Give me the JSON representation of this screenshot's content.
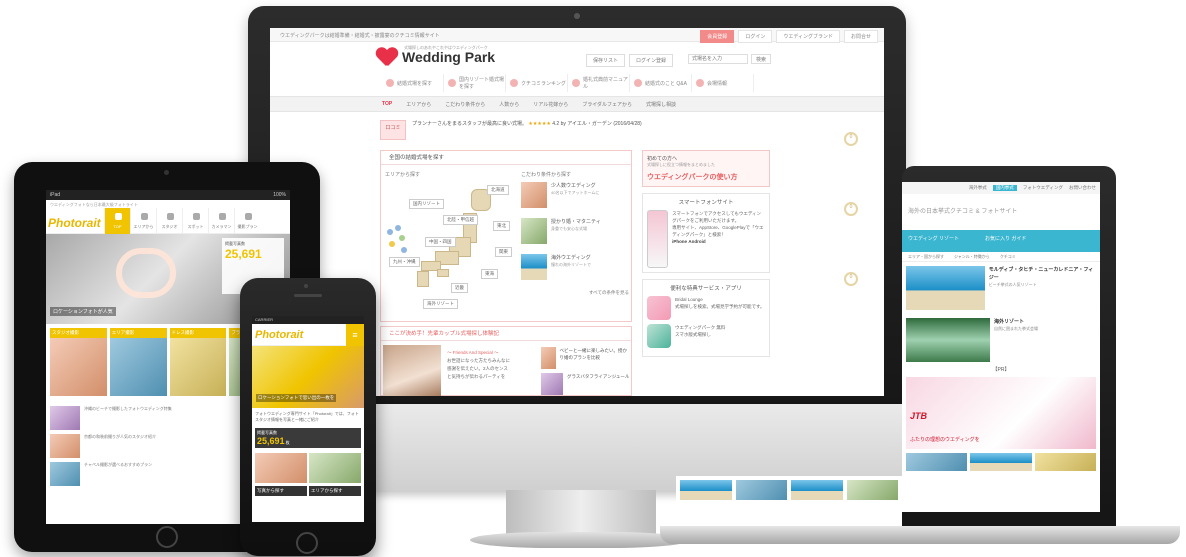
{
  "monitor": {
    "tagline": "ウエディングパークは結婚準備・結婚式・披露宴のクチコミ情報サイト",
    "top_links": [
      "会員登録",
      "ログイン",
      "ウエディングブランド",
      "お問合せ"
    ],
    "brand": "Wedding Park",
    "brand_sub": "式場探しのあれやこれやはウエディングパーク",
    "header_buttons": [
      "保存リスト",
      "ログイン登録"
    ],
    "search_placeholder": "式場名を入力",
    "search_button": "検索",
    "icon_nav": [
      "結婚式場を探す",
      "国内リゾート婚式場を探す",
      "クチコミランキング",
      "婚礼式典前マニュアル",
      "結婚式のこと Q&A",
      "会場情報"
    ],
    "global_nav": [
      "TOP",
      "エリアから",
      "こだわり条件から",
      "人数から",
      "リアル花嫁から",
      "ブライダルフェアから",
      "式場探し相談"
    ],
    "review": {
      "badge": "口コミ",
      "text": "プランナーさんをまるスタッフが最高に良い式場。",
      "stars": "★★★★★",
      "score": "4.2",
      "meta": "by アイエル・ガーデン (2016/04/28)"
    },
    "circle_labels": [
      "0",
      "0",
      "0"
    ],
    "map_panel": {
      "title": "全国の結婚式場を探す",
      "area_sub": "エリアから探す",
      "cond_sub": "こだわり条件から探す",
      "labels": [
        "北海道",
        "東北",
        "関東",
        "東海",
        "北陸・甲信越",
        "近畿",
        "中国・四国",
        "九州・沖縄",
        "国内リゾート",
        "海外リゾート"
      ],
      "conditions": [
        {
          "label": "少人数ウエディング",
          "small": "40名以下でアットホームに"
        },
        {
          "label": "授かり婚・マタニティ",
          "small": "身重でも安心な式場"
        },
        {
          "label": "海外ウエディング",
          "small": "憧れの海外リゾートで"
        }
      ],
      "more": "すべての条件を見る"
    },
    "lower_panel": {
      "title": "ここが決め手！先輩カップル式場探し体験記",
      "text_lines": [
        "〜 Friends And Special 〜",
        "お世話になった方たちみんなに",
        "感謝を伝えたい。2人のセンス",
        "と気持ちが伝わるパーティを"
      ],
      "items": [
        "ベビーと一緒に楽しみたい。授かり婚のプランを比較",
        "グラスバタフライアンジュール"
      ]
    },
    "first_visit": {
      "heading": "初めての方へ",
      "small": "式場探しに役立つ情報をまとめました",
      "big": "ウエディングパークの使い方"
    },
    "smartphone": {
      "title": "スマートフォンサイト",
      "text": "スマートフォンでアクセスしてもウエディングパークをご利用いただけます。",
      "text2": "専用サイト、AppStore、GooglePlayで「ウエディングパーク」と検索！",
      "os_ios": "iPhone",
      "os_android": "Android"
    },
    "apps": {
      "title": "便利な特典サービス・アプリ",
      "items": [
        {
          "name": "Bridal Lounge",
          "desc": "式場探しを検索。式場見学予約が可能です。"
        },
        {
          "name": "ウエディングパーク 無料",
          "desc": "スマホ版式場探し"
        }
      ]
    }
  },
  "tablet": {
    "status_left": "iPad",
    "status_right": "100%",
    "topline": "ウエディングフォトなら日本最大級フォトライト",
    "logo": "Photorait",
    "tabs": [
      "TOP",
      "エリアから",
      "スタジオ",
      "スポット",
      "カメラマン",
      "撮影プラン"
    ],
    "hero_caption": "ロケーションフォトが人気",
    "panel_label": "掲載写真数",
    "panel_number": "25,691",
    "categories": [
      "スタジオ撮影",
      "エリア撮影",
      "ドレス撮影",
      "プラン撮影"
    ],
    "list": [
      "沖縄のビーチで撮影したフォトウエディング特集",
      "京都の和装前撮りが人気のスタジオ紹介",
      "チャペル撮影が選べるおすすめプラン"
    ]
  },
  "phone": {
    "status": "CARRIER",
    "logo": "Photorait",
    "menu": "≡",
    "hero_caption": "ロケーションフォトで思い出の一枚を",
    "text": "フォトウエディング専門サイト「Photorait」では、フォトスタジオ情報を写真と一緒にご紹介",
    "count_label": "掲載写真数",
    "count_number": "25,691",
    "count_unit": "枚",
    "buttons": [
      "写真から探す",
      "エリアから探す"
    ]
  },
  "laptop": {
    "top_links": [
      "海外挙式",
      "国内挙式",
      "フォトウエディング",
      "お問い合わせ"
    ],
    "head": "海外の日本挙式クチコミ & フォトサイト",
    "bar": [
      "ウエディング リゾート",
      "お気に入り ガイド"
    ],
    "subnav": [
      "エリア・国から探す",
      "ジャンル・特徴から",
      "クチコミ"
    ],
    "rows": [
      {
        "title": "モルディブ・タヒチ・ニューカレドニア・フィジー",
        "sub": "ビーチ挙式の人気リゾート"
      },
      {
        "title": "海外リゾート",
        "sub": "自然に囲まれた挙式会場"
      }
    ],
    "pin": "【PR】",
    "jtb_logo": "JTB",
    "jtb_caption": "ふたりの理想のウエディングを"
  }
}
